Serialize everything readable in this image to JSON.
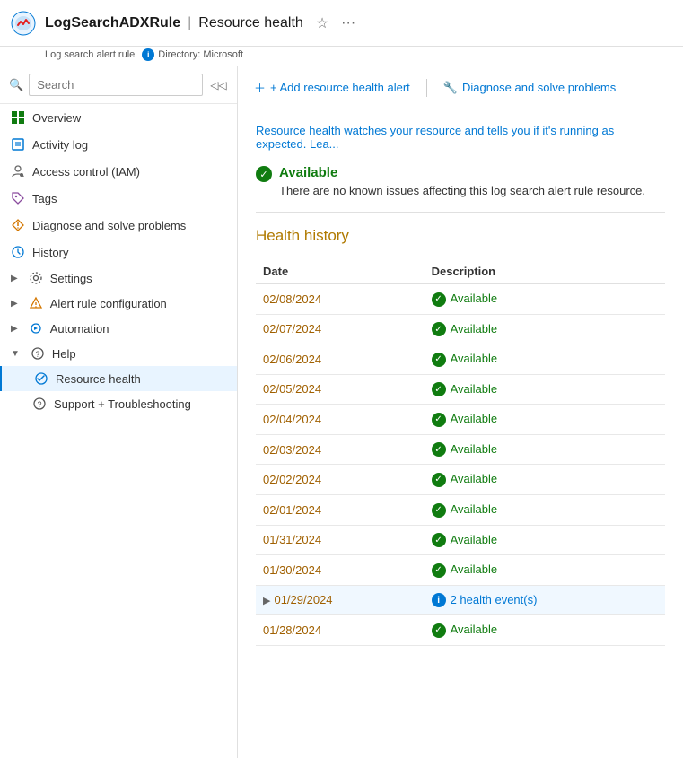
{
  "topbar": {
    "icon_alt": "azure-monitor-icon",
    "resource_name": "LogSearchADXRule",
    "separator": "|",
    "page_title": "Resource health",
    "resource_type": "Log search alert rule",
    "directory_label": "Directory: Microsoft"
  },
  "toolbar": {
    "add_alert_label": "+ Add resource health alert",
    "diagnose_label": "Diagnose and solve problems"
  },
  "search": {
    "placeholder": "Search"
  },
  "sidebar": {
    "items": [
      {
        "id": "overview",
        "label": "Overview",
        "icon": "overview-icon",
        "type": "item",
        "active": false
      },
      {
        "id": "activity-log",
        "label": "Activity log",
        "icon": "activity-log-icon",
        "type": "item",
        "active": false
      },
      {
        "id": "access-control",
        "label": "Access control (IAM)",
        "icon": "access-control-icon",
        "type": "item",
        "active": false
      },
      {
        "id": "tags",
        "label": "Tags",
        "icon": "tags-icon",
        "type": "item",
        "active": false
      },
      {
        "id": "diagnose",
        "label": "Diagnose and solve problems",
        "icon": "diagnose-icon",
        "type": "item",
        "active": false
      },
      {
        "id": "history",
        "label": "History",
        "icon": "history-icon",
        "type": "item",
        "active": false
      },
      {
        "id": "settings",
        "label": "Settings",
        "icon": "settings-icon",
        "type": "group",
        "expanded": false
      },
      {
        "id": "alert-rule-config",
        "label": "Alert rule configuration",
        "icon": "alert-icon",
        "type": "group",
        "expanded": false
      },
      {
        "id": "automation",
        "label": "Automation",
        "icon": "automation-icon",
        "type": "group",
        "expanded": false
      },
      {
        "id": "help",
        "label": "Help",
        "icon": "help-icon",
        "type": "group",
        "expanded": true
      },
      {
        "id": "resource-health",
        "label": "Resource health",
        "icon": "resource-health-icon",
        "type": "subitem",
        "active": true
      },
      {
        "id": "support-troubleshooting",
        "label": "Support + Troubleshooting",
        "icon": "support-icon",
        "type": "subitem",
        "active": false
      }
    ]
  },
  "content": {
    "info_banner": "Resource health watches your resource and tells you if it's running as expected. Lea...",
    "status": {
      "label": "Available",
      "description": "There are no known issues affecting this log search alert rule resource."
    },
    "health_history": {
      "title": "Health history",
      "columns": [
        "Date",
        "Description"
      ],
      "rows": [
        {
          "date": "02/08/2024",
          "status": "available",
          "description": "Available",
          "expanded": false,
          "highlighted": false
        },
        {
          "date": "02/07/2024",
          "status": "available",
          "description": "Available",
          "expanded": false,
          "highlighted": false
        },
        {
          "date": "02/06/2024",
          "status": "available",
          "description": "Available",
          "expanded": false,
          "highlighted": false
        },
        {
          "date": "02/05/2024",
          "status": "available",
          "description": "Available",
          "expanded": false,
          "highlighted": false
        },
        {
          "date": "02/04/2024",
          "status": "available",
          "description": "Available",
          "expanded": false,
          "highlighted": false
        },
        {
          "date": "02/03/2024",
          "status": "available",
          "description": "Available",
          "expanded": false,
          "highlighted": false
        },
        {
          "date": "02/02/2024",
          "status": "available",
          "description": "Available",
          "expanded": false,
          "highlighted": false
        },
        {
          "date": "02/01/2024",
          "status": "available",
          "description": "Available",
          "expanded": false,
          "highlighted": false
        },
        {
          "date": "01/31/2024",
          "status": "available",
          "description": "Available",
          "expanded": false,
          "highlighted": false
        },
        {
          "date": "01/30/2024",
          "status": "available",
          "description": "Available",
          "expanded": false,
          "highlighted": false
        },
        {
          "date": "01/29/2024",
          "status": "event",
          "description": "2 health event(s)",
          "expanded": false,
          "highlighted": true
        },
        {
          "date": "01/28/2024",
          "status": "available",
          "description": "Available",
          "expanded": false,
          "highlighted": false
        }
      ]
    }
  }
}
